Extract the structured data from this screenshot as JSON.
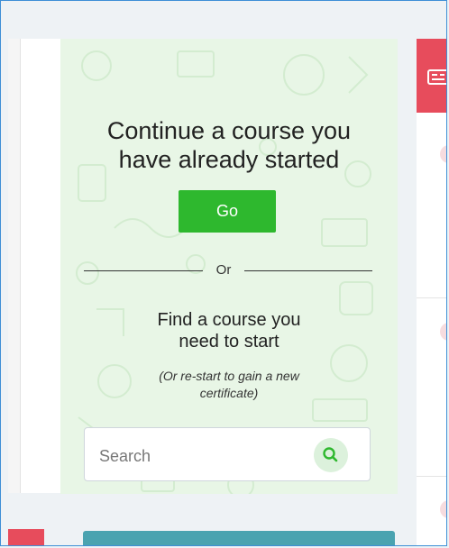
{
  "continue_card": {
    "title_line1": "Continue a course you",
    "title_line2": "have already started",
    "go_label": "Go",
    "or_label": "Or",
    "find_line1": "Find a course you",
    "find_line2": "need to start",
    "note_line1": "(Or re-start to gain a new",
    "note_line2": "certificate)"
  },
  "search": {
    "placeholder": "Search",
    "value": "",
    "icon": "search-icon"
  },
  "right_panel": {
    "header_icon": "newspaper-icon"
  },
  "colors": {
    "accent_green": "#2eb82e",
    "card_background": "#e8f6e6",
    "red_header": "#e74c5c",
    "teal_button": "#4aa3b0",
    "frame_border": "#3d8fd6"
  }
}
